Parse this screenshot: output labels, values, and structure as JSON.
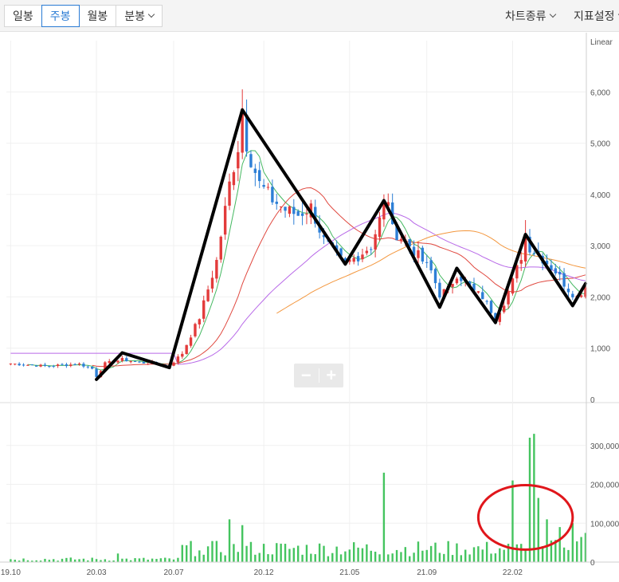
{
  "toolbar": {
    "tabs": [
      {
        "label": "일봉",
        "active": false
      },
      {
        "label": "주봉",
        "active": true
      },
      {
        "label": "월봉",
        "active": false
      },
      {
        "label": "분봉",
        "active": false
      }
    ],
    "chart_type_label": "차트종류",
    "indicator_label": "지표설정"
  },
  "colors": {
    "accent": "#2a7bd4",
    "up": "#e33b3b",
    "down": "#2d7fd6",
    "volume": "#44c45f",
    "ma5": "#44b860",
    "ma20": "#e0483f",
    "ma60": "#b869e8",
    "ma120": "#f3973e",
    "annotation_line": "#000000",
    "annotation_circle": "#e0161b"
  },
  "chart_data": {
    "type": "line",
    "scale_label": "Linear",
    "price_axis": {
      "ylim": [
        0,
        7000
      ],
      "ticks": [
        "0",
        "1,000",
        "2,000",
        "3,000",
        "4,000",
        "5,000",
        "6,000"
      ]
    },
    "volume_axis": {
      "ylim": [
        0,
        400000
      ],
      "ticks": [
        "0",
        "100,000,",
        "200,000,",
        "300,000,"
      ]
    },
    "x_ticks": [
      {
        "label": "19.10",
        "t": 0
      },
      {
        "label": "20.03",
        "t": 20
      },
      {
        "label": "20.07",
        "t": 38
      },
      {
        "label": "20.12",
        "t": 59
      },
      {
        "label": "21.05",
        "t": 79
      },
      {
        "label": "21.09",
        "t": 97
      },
      {
        "label": "22.02",
        "t": 117
      }
    ],
    "x_range": [
      -1,
      134
    ],
    "zigzag_annotation": [
      [
        20,
        390
      ],
      [
        26,
        910
      ],
      [
        37,
        620
      ],
      [
        54,
        5650
      ],
      [
        78,
        2640
      ],
      [
        87,
        3880
      ],
      [
        100,
        1800
      ],
      [
        104,
        2560
      ],
      [
        113,
        1500
      ],
      [
        120,
        3220
      ],
      [
        131,
        1830
      ],
      [
        134,
        2260
      ]
    ],
    "volume_highlight": {
      "center_t": 120,
      "center_value": 115000,
      "t_radius": 11,
      "value_radius": 83000
    },
    "key_highs": [
      {
        "t": 54,
        "value": 6050
      },
      {
        "t": 88,
        "value": 4150
      },
      {
        "t": 120,
        "value": 3500
      }
    ]
  }
}
